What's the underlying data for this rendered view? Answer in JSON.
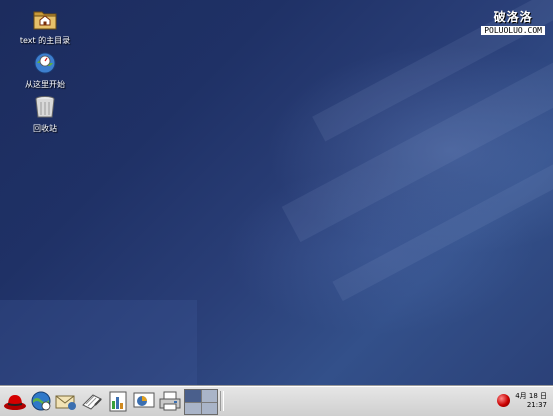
{
  "watermark": {
    "title": "破洛洛",
    "url": "POLUOLUO.COM"
  },
  "desktop_icons": [
    {
      "name": "home-folder",
      "label": "text 的主目录",
      "icon": "home-folder-icon"
    },
    {
      "name": "start-here",
      "label": "从这里开始",
      "icon": "start-here-icon"
    },
    {
      "name": "trash",
      "label": "回收站",
      "icon": "trash-icon"
    }
  ],
  "taskbar": {
    "launchers": [
      "redhat-menu-icon",
      "web-browser-icon",
      "email-icon",
      "writer-icon",
      "spreadsheet-icon",
      "presentation-icon",
      "printer-icon"
    ],
    "workspaces": 4,
    "active_workspace": 1,
    "clock": {
      "date": "4月 18 日",
      "time": "21:37"
    }
  },
  "colors": {
    "desktop": "#23356a",
    "taskbar": "#d9d9d9",
    "alert": "#c90000"
  }
}
